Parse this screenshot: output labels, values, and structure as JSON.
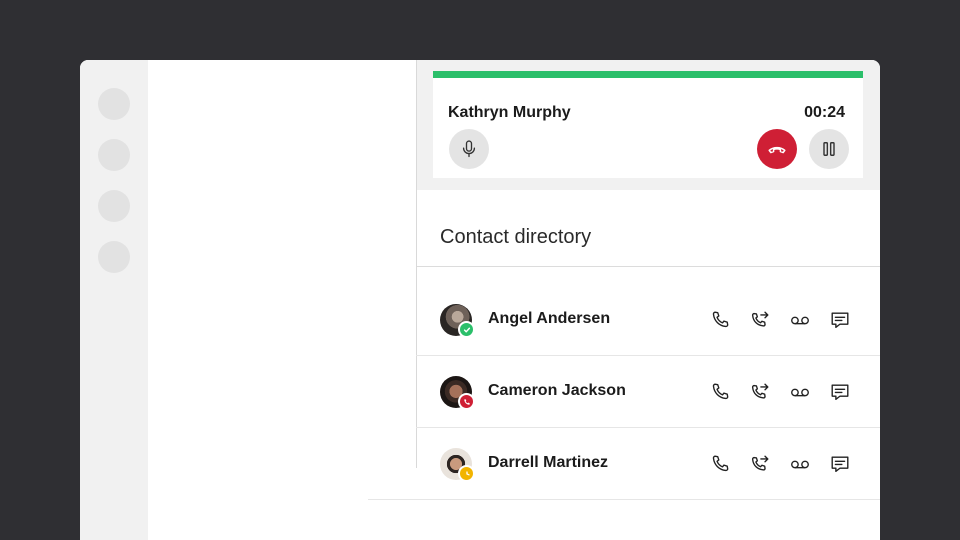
{
  "active_call": {
    "caller_name": "Kathryn Murphy",
    "duration": "00:24",
    "progress": 1.0,
    "controls": [
      "microphone-icon",
      "hang-up-icon",
      "pause-icon"
    ]
  },
  "directory": {
    "title": "Contact directory",
    "contacts": [
      {
        "name": "Angel Andersen",
        "status": "available",
        "status_color": "#2bbf6a"
      },
      {
        "name": "Cameron Jackson",
        "status": "on-call",
        "status_color": "#cf1f35"
      },
      {
        "name": "Darrell Martinez",
        "status": "away",
        "status_color": "#f2b400"
      }
    ],
    "row_actions": [
      "phone-icon",
      "call-forward-icon",
      "voicemail-icon",
      "chat-icon"
    ]
  },
  "colors": {
    "accent_green": "#2bbf6a",
    "hangup_red": "#cf1f35",
    "background": "#2f2f33"
  }
}
